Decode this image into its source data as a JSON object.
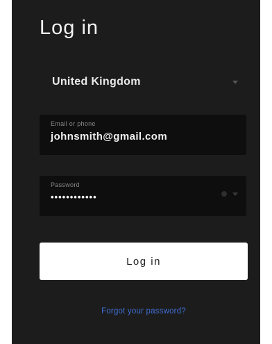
{
  "page": {
    "title": "Log in"
  },
  "country_select": {
    "value": "United Kingdom",
    "icon": "chevron-down-icon"
  },
  "email": {
    "label": "Email or phone",
    "value": "johnsmith@gmail.com"
  },
  "password": {
    "label": "Password",
    "masked_value": "••••••••••••",
    "icons": [
      "eye-icon",
      "chevron-down-icon"
    ]
  },
  "actions": {
    "login_label": "Log in",
    "forgot_label": "Forgot your password?"
  },
  "colors": {
    "panel_bg": "#1c1c1c",
    "field_bg": "#0e0e0e",
    "button_bg": "#ffffff",
    "link": "#3f6fd6"
  }
}
